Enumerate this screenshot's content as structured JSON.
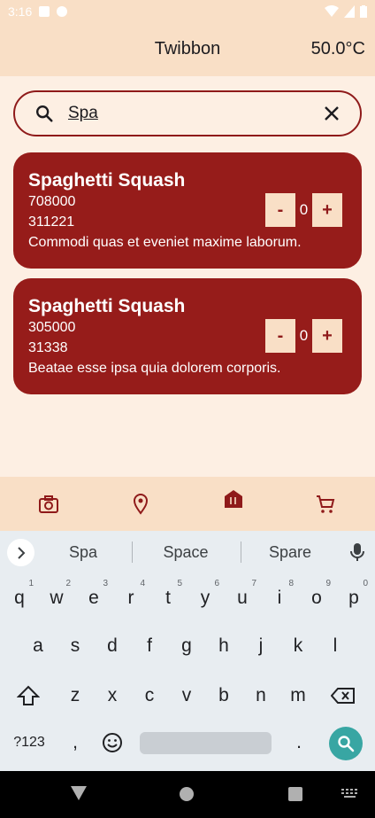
{
  "status_bar": {
    "time": "3:16"
  },
  "app_bar": {
    "title": "Twibbon",
    "temperature": "50.0°C"
  },
  "search": {
    "value": "Spa",
    "icon": "search-icon",
    "clear_icon": "close-icon"
  },
  "results": [
    {
      "title": "Spaghetti Squash",
      "price": "708000",
      "code": "311221",
      "description": "Commodi quas et eveniet maxime laborum.",
      "quantity": "0",
      "minus": "-",
      "plus": "+"
    },
    {
      "title": "Spaghetti Squash",
      "price": "305000",
      "code": "31338",
      "description": "Beatae esse ipsa quia dolorem corporis.",
      "quantity": "0",
      "minus": "-",
      "plus": "+"
    }
  ],
  "bottom_nav": [
    {
      "icon": "camera-icon"
    },
    {
      "icon": "location-pin-icon"
    },
    {
      "icon": "restaurant-store-icon",
      "selected": true
    },
    {
      "icon": "cart-icon"
    }
  ],
  "keyboard": {
    "suggestions": [
      "Spa",
      "Space",
      "Spare"
    ],
    "row1": [
      "q",
      "w",
      "e",
      "r",
      "t",
      "y",
      "u",
      "i",
      "o",
      "p"
    ],
    "row1_hints": [
      "1",
      "2",
      "3",
      "4",
      "5",
      "6",
      "7",
      "8",
      "9",
      "0"
    ],
    "row2": [
      "a",
      "s",
      "d",
      "f",
      "g",
      "h",
      "j",
      "k",
      "l"
    ],
    "row3": [
      "z",
      "x",
      "c",
      "v",
      "b",
      "n",
      "m"
    ],
    "symbols_key": "?123",
    "comma_key": ",",
    "period_key": "."
  },
  "colors": {
    "primary": "#961c1a",
    "surface": "#fdefe3",
    "bar": "#f9dfc6",
    "accent": "#38a6a3"
  }
}
